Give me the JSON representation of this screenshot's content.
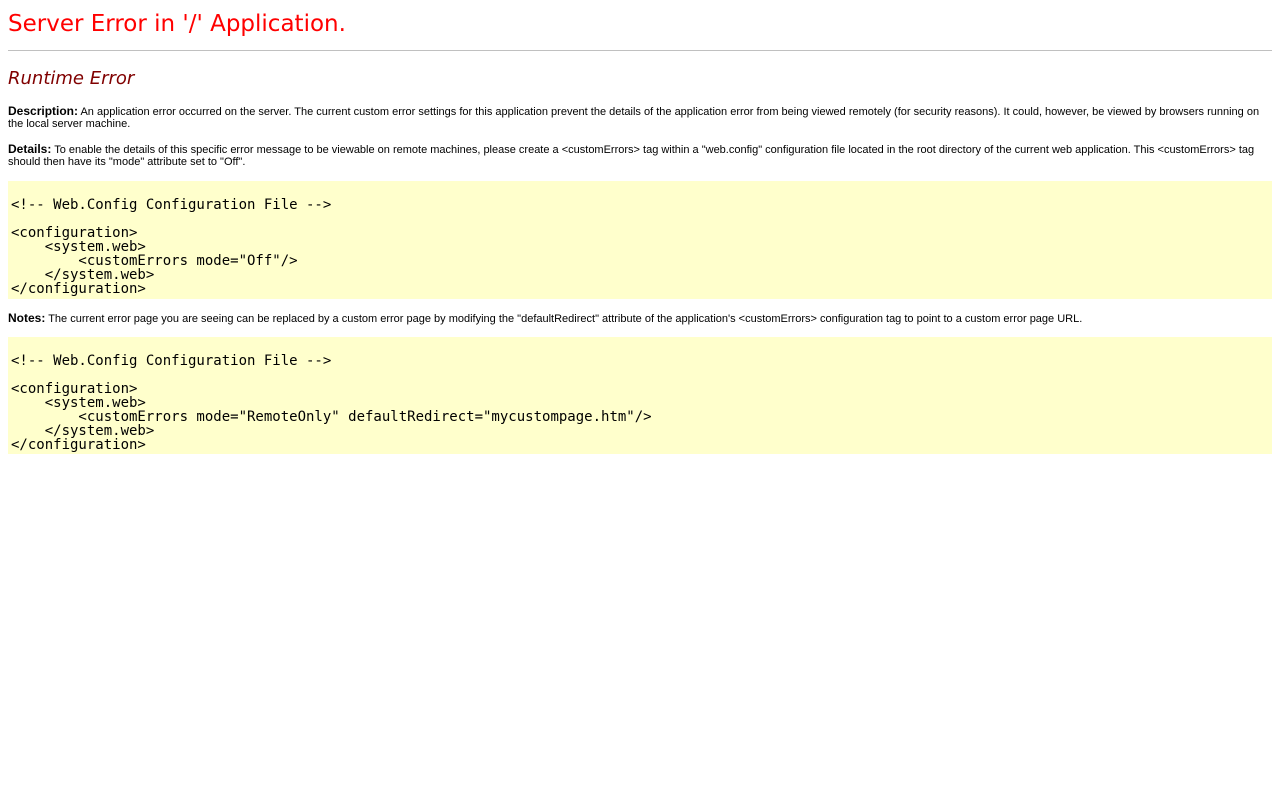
{
  "page": {
    "title": "Server Error in '/' Application.",
    "subtitle": "Runtime Error"
  },
  "description": {
    "label": "Description:",
    "text": " An application error occurred on the server. The current custom error settings for this application prevent the details of the application error from being viewed remotely (for security reasons). It could, however, be viewed by browsers running on the local server machine."
  },
  "details": {
    "label": "Details:",
    "text": " To enable the details of this specific error message to be viewable on remote machines, please create a <customErrors> tag within a \"web.config\" configuration file located in the root directory of the current web application. This <customErrors> tag should then have its \"mode\" attribute set to \"Off\"."
  },
  "code_block_1": "\n<!-- Web.Config Configuration File -->\n\n<configuration>\n    <system.web>\n        <customErrors mode=\"Off\"/>\n    </system.web>\n</configuration>",
  "notes": {
    "label": "Notes:",
    "text": " The current error page you are seeing can be replaced by a custom error page by modifying the \"defaultRedirect\" attribute of the application's <customErrors> configuration tag to point to a custom error page URL."
  },
  "code_block_2": "\n<!-- Web.Config Configuration File -->\n\n<configuration>\n    <system.web>\n        <customErrors mode=\"RemoteOnly\" defaultRedirect=\"mycustompage.htm\"/>\n    </system.web>\n</configuration>",
  "colors": {
    "title": "#ff0000",
    "subtitle": "#800000",
    "code_background": "#ffffcc",
    "rule": "#c0c0c0"
  }
}
